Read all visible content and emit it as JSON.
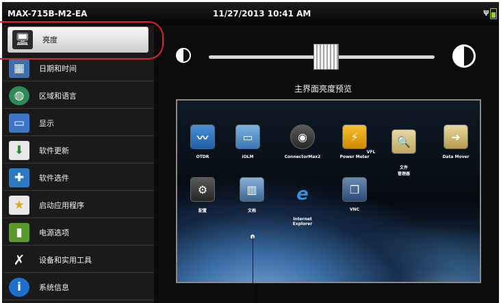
{
  "titlebar": {
    "model": "MAX-715B-M2-EA",
    "datetime": "11/27/2013 10:41 AM"
  },
  "sidebar": {
    "items": [
      {
        "label": "亮度",
        "icon": "monitor-gear-icon",
        "active": true
      },
      {
        "label": "日期和时间",
        "icon": "calendar-clock-icon"
      },
      {
        "label": "区域和语言",
        "icon": "globe-icon"
      },
      {
        "label": "显示",
        "icon": "display-icon"
      },
      {
        "label": "软件更新",
        "icon": "download-icon"
      },
      {
        "label": "软件选件",
        "icon": "puzzle-icon"
      },
      {
        "label": "启动应用程序",
        "icon": "star-window-icon"
      },
      {
        "label": "电源选项",
        "icon": "battery-gear-icon"
      },
      {
        "label": "设备和实用工具",
        "icon": "tools-icon"
      },
      {
        "label": "系统信息",
        "icon": "info-icon"
      }
    ]
  },
  "brightness": {
    "preview_label": "主界面亮度预览",
    "level": 0.5
  },
  "preview": {
    "apps": [
      {
        "label": "OTDR",
        "icon": "otdr-icon"
      },
      {
        "label": "iOLM",
        "icon": "iolm-icon"
      },
      {
        "label": "ConnectorMax2",
        "icon": "connector-icon"
      },
      {
        "label": "Power Meter",
        "icon": "power-meter-icon"
      },
      {
        "label": "VFL",
        "icon": "vfl-icon"
      },
      {
        "label": "文件\n管理器",
        "icon": "file-manager-icon"
      },
      {
        "label": "Data Mover",
        "icon": "data-mover-icon"
      },
      {
        "label": "配置",
        "icon": "gear-icon"
      },
      {
        "label": "文档",
        "icon": "books-icon"
      },
      {
        "label": "Internet\nExplorer",
        "icon": "ie-icon"
      },
      {
        "label": "VNC",
        "icon": "vnc-icon"
      }
    ]
  }
}
